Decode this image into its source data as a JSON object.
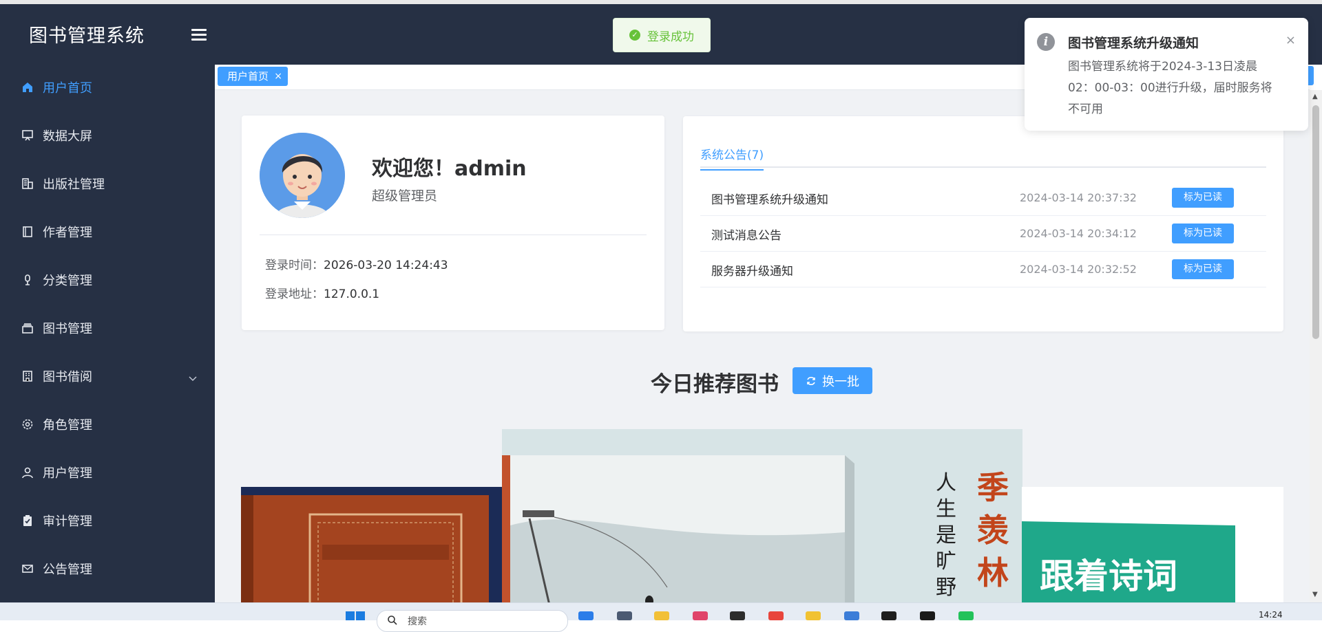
{
  "app": {
    "title": "图书管理系统"
  },
  "sidebar": {
    "items": [
      {
        "label": "用户首页",
        "icon": "home-icon",
        "active": true
      },
      {
        "label": "数据大屏",
        "icon": "monitor-icon"
      },
      {
        "label": "出版社管理",
        "icon": "building-icon"
      },
      {
        "label": "作者管理",
        "icon": "notebook-icon"
      },
      {
        "label": "分类管理",
        "icon": "microphone-icon"
      },
      {
        "label": "图书管理",
        "icon": "stack-icon"
      },
      {
        "label": "图书借阅",
        "icon": "office-icon",
        "expandable": true
      },
      {
        "label": "角色管理",
        "icon": "gear-icon"
      },
      {
        "label": "用户管理",
        "icon": "user-icon"
      },
      {
        "label": "审计管理",
        "icon": "clipboard-icon"
      },
      {
        "label": "公告管理",
        "icon": "mail-icon"
      }
    ]
  },
  "tabs": [
    {
      "label": "用户首页",
      "close": "×"
    }
  ],
  "toast": {
    "text": "登录成功"
  },
  "notification": {
    "title": "图书管理系统升级通知",
    "body": "图书管理系统将于2024-3-13日凌晨02：00-03：00进行升级，届时服务将不可用",
    "close": "×"
  },
  "user_card": {
    "welcome": "欢迎您！admin",
    "role": "超级管理员",
    "login_time_label": "登录时间：",
    "login_time": "2026-03-20 14:24:43",
    "login_addr_label": "登录地址：",
    "login_addr": "127.0.0.1"
  },
  "notices": {
    "tab_label": "系统公告(7)",
    "mark_label": "标为已读",
    "rows": [
      {
        "title": "图书管理系统升级通知",
        "time": "2024-03-14 20:37:32"
      },
      {
        "title": "测试消息公告",
        "time": "2024-03-14 20:34:12"
      },
      {
        "title": "服务器升级通知",
        "time": "2024-03-14 20:32:52"
      }
    ]
  },
  "recommend": {
    "title": "今日推荐图书",
    "refresh_label": "换一批",
    "covers": {
      "center_vertical": "人生是旷野",
      "center_red": "季羡林",
      "right": "跟着诗词"
    }
  },
  "taskbar": {
    "search_placeholder": "搜索",
    "time": "14:24"
  },
  "colors": {
    "accent": "#409eff",
    "sidebar_bg": "#263044",
    "success": "#67c23a"
  }
}
